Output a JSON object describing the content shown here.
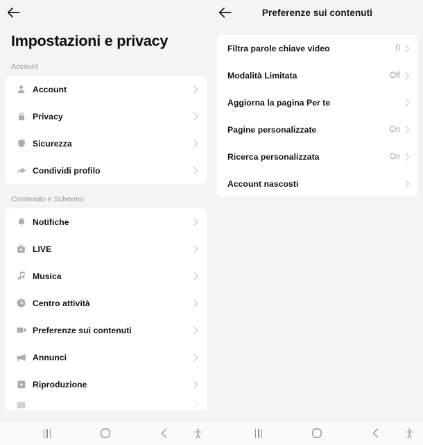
{
  "left": {
    "back_icon": "back-arrow-icon",
    "page_title": "Impostazioni e privacy",
    "sections": [
      {
        "label": "Account",
        "items": [
          {
            "icon": "person-icon",
            "label": "Account"
          },
          {
            "icon": "lock-icon",
            "label": "Privacy"
          },
          {
            "icon": "shield-icon",
            "label": "Sicurezza"
          },
          {
            "icon": "share-icon",
            "label": "Condividi profilo"
          }
        ]
      },
      {
        "label": "Contenuto e Schermo",
        "items": [
          {
            "icon": "bell-icon",
            "label": "Notifiche"
          },
          {
            "icon": "live-icon",
            "label": "LIVE"
          },
          {
            "icon": "music-note-icon",
            "label": "Musica"
          },
          {
            "icon": "clock-icon",
            "label": "Centro attività"
          },
          {
            "icon": "video-camera-icon",
            "label": "Preferenze sui contenuti"
          },
          {
            "icon": "megaphone-icon",
            "label": "Annunci"
          },
          {
            "icon": "play-box-icon",
            "label": "Riproduzione"
          }
        ]
      }
    ]
  },
  "right": {
    "back_icon": "back-arrow-icon",
    "title": "Preferenze sui contenuti",
    "items": [
      {
        "label": "Filtra parole chiave video",
        "value": "0"
      },
      {
        "label": "Modalità Limitata",
        "value": "Off"
      },
      {
        "label": "Aggiorna la pagina Per te",
        "value": ""
      },
      {
        "label": "Pagine personalizzate",
        "value": "On"
      },
      {
        "label": "Ricerca personalizzata",
        "value": "On"
      },
      {
        "label": "Account nascosti",
        "value": ""
      }
    ]
  },
  "navbar": {
    "recents": "recents-icon",
    "home": "home-icon",
    "back": "back-icon",
    "accessibility": "accessibility-icon"
  },
  "colors": {
    "background": "#f4f4f4",
    "card": "#ffffff",
    "text": "#121212",
    "muted": "#9b9b9b",
    "icon": "#adadad"
  }
}
